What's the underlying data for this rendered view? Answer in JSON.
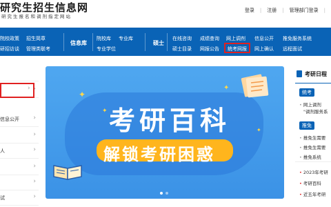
{
  "header": {
    "logo_title": "研究生招生信息网",
    "logo_subtitle": "研究生报名和调剂指定网站",
    "links": [
      "登录",
      "注册",
      "管理部门登录"
    ]
  },
  "nav": {
    "col1": [
      "院校政策",
      "招生简章",
      "研招访谈",
      "管理类联考"
    ],
    "col2_label": "信息库",
    "col2": [
      "院校库",
      "专业库",
      "专业学位"
    ],
    "col3_label": "硕士",
    "col3": [
      "在线咨询",
      "成绩查询",
      "网上调剂",
      "信息公开",
      "推免服务系统",
      "硕士目录",
      "网报公告",
      "统考网报",
      "网上确认",
      "远程面试"
    ],
    "highlighted": "统考网报"
  },
  "sidebar": {
    "items": [
      "",
      "",
      "信息公开",
      "",
      "人",
      "",
      "",
      "试"
    ]
  },
  "banner": {
    "title": "考研百科",
    "subtitle": "解锁考研困惑",
    "slide_count": 2,
    "active_slide": 0
  },
  "right_panel": {
    "heading": "考研日程",
    "tab1": "统考",
    "tab1_items": [
      "网上调剂",
      "\"调剂服务系"
    ],
    "tab2": "推免",
    "tab2_items": [
      "推免生需要",
      "推免生需要",
      "推免系统"
    ],
    "dates": [
      "2023年考研",
      "考研百科",
      "近五年考研"
    ]
  },
  "colors": {
    "nav_blue": "#0a63b6",
    "highlight_red": "#e02020",
    "banner_blue": "#3b92e6",
    "banner_yellow": "#ffb51d"
  }
}
